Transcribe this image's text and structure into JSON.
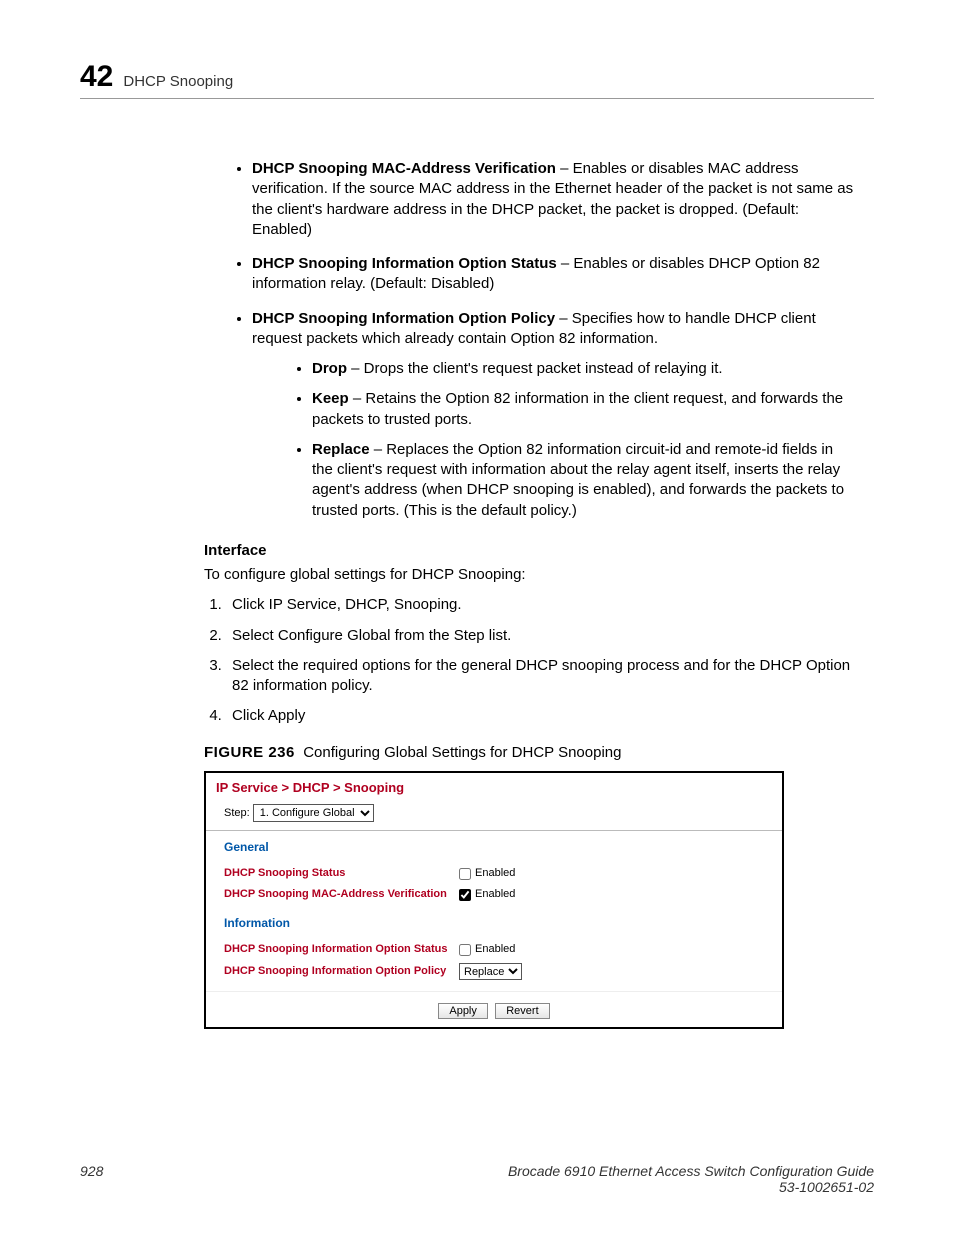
{
  "header": {
    "chapnum": "42",
    "title": "DHCP Snooping"
  },
  "bullets1": [
    {
      "term": "DHCP Snooping MAC-Address Verification",
      "desc": " – Enables or disables MAC address verification. If the source MAC address in the Ethernet header of the packet is not same as the client's hardware address in the DHCP packet, the packet is dropped. (Default: Enabled)"
    },
    {
      "term": "DHCP Snooping Information Option Status",
      "desc": " – Enables or disables DHCP Option 82 information relay. (Default: Disabled)"
    },
    {
      "term": "DHCP Snooping Information Option Policy",
      "desc": " – Specifies how to handle DHCP client request packets which already contain Option 82 information."
    }
  ],
  "bullets2": [
    {
      "term": "Drop",
      "desc": " – Drops the client's request packet instead of relaying it."
    },
    {
      "term": "Keep",
      "desc": " – Retains the Option 82 information in the client request, and forwards the packets to trusted ports."
    },
    {
      "term": "Replace",
      "desc": " – Replaces the Option 82 information circuit-id and remote-id fields in the client's request with information about the relay agent itself, inserts the relay agent's address (when DHCP snooping is enabled), and forwards the packets to trusted ports. (This is the default policy.)"
    }
  ],
  "interface": {
    "heading": "Interface",
    "intro": "To configure global settings for DHCP Snooping:",
    "steps": [
      "Click IP Service, DHCP, Snooping.",
      "Select Configure Global from the Step list.",
      "Select the required options for the general DHCP snooping process and for the DHCP Option 82 information policy.",
      "Click Apply"
    ]
  },
  "figure": {
    "label": "FIGURE 236",
    "caption": "Configuring Global Settings for DHCP Snooping"
  },
  "panel": {
    "breadcrumb": "IP Service > DHCP > Snooping",
    "step_label": "Step:",
    "step_value": "1. Configure Global",
    "general_title": "General",
    "info_title": "Information",
    "enabled_label": "Enabled",
    "rows": {
      "r1": "DHCP Snooping Status",
      "r2": "DHCP Snooping MAC-Address Verification",
      "r3": "DHCP Snooping Information Option Status",
      "r4": "DHCP Snooping Information Option Policy"
    },
    "policy_value": "Replace",
    "apply": "Apply",
    "revert": "Revert"
  },
  "footer": {
    "page": "928",
    "book": "Brocade 6910 Ethernet Access Switch Configuration Guide",
    "docno": "53-1002651-02"
  }
}
